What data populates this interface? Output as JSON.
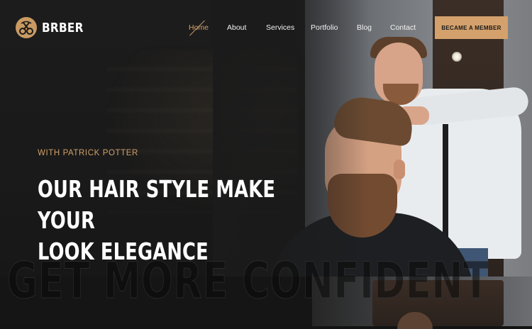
{
  "brand": {
    "name": "BRBER",
    "logo_icon": "barber-clipper-icon",
    "accent": "#d4a16c"
  },
  "nav": {
    "items": [
      {
        "label": "Home",
        "active": true
      },
      {
        "label": "About",
        "active": false
      },
      {
        "label": "Services",
        "active": false
      },
      {
        "label": "Portfolio",
        "active": false
      },
      {
        "label": "Blog",
        "active": false
      },
      {
        "label": "Contact",
        "active": false
      }
    ],
    "cta_label": "BECAME A MEMBER"
  },
  "hero": {
    "kicker": "WITH PATRICK POTTER",
    "headline_line1": "OUR HAIR STYLE MAKE YOUR",
    "headline_line2": "LOOK ELEGANCE",
    "background_text": "GET MORE CONFIDENT"
  }
}
